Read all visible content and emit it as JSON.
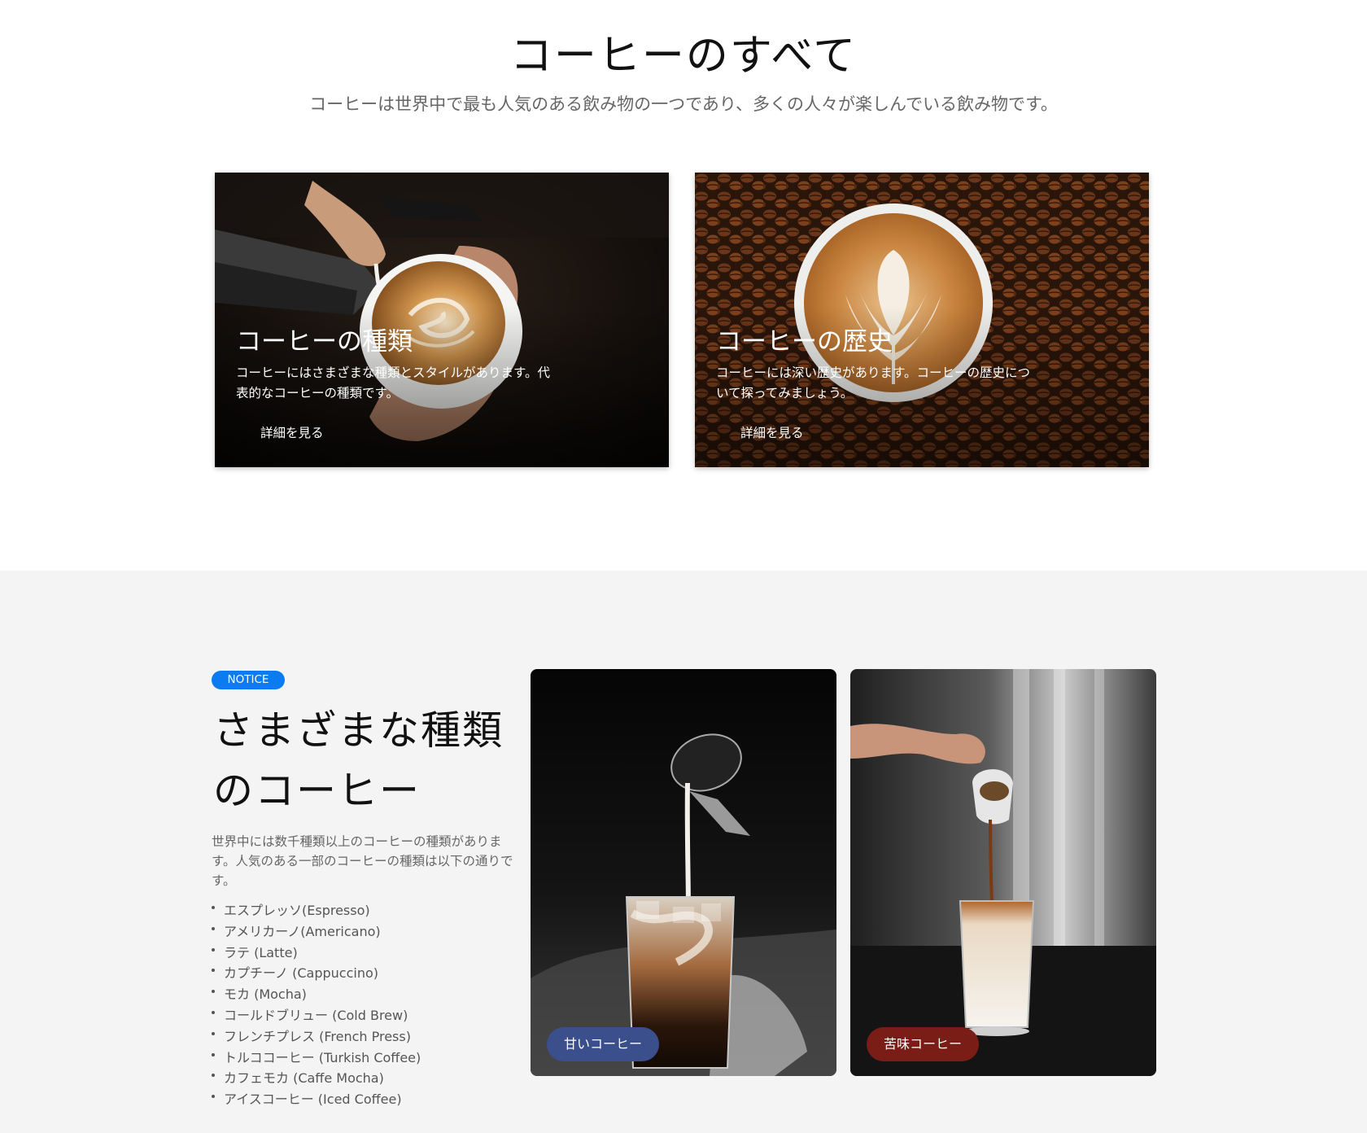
{
  "hero": {
    "title": "コーヒーのすべて",
    "subtitle": "コーヒーは世界中で最も人気のある飲み物の一つであり、多くの人々が楽しんでいる飲み物です。"
  },
  "cards": [
    {
      "title": "コーヒーの種類",
      "description": "コーヒーにはさまざまな種類とスタイルがあります。代表的なコーヒーの種類です。",
      "button": "詳細を見る"
    },
    {
      "title": "コーヒーの歴史",
      "description": "コーヒーには深い歴史があります。コーヒーの歴史について探ってみましょう。",
      "button": "詳細を見る"
    }
  ],
  "types_section": {
    "badge": "NOTICE",
    "heading": "さまざまな種類のコーヒー",
    "intro": "世界中には数千種類以上のコーヒーの種類があります。人気のある一部のコーヒーの種類は以下の通りです。",
    "items": [
      "エスプレッソ(Espresso)",
      "アメリカーノ(Americano)",
      "ラテ (Latte)",
      "カプチーノ (Cappuccino)",
      "モカ (Mocha)",
      "コールドブリュー (Cold Brew)",
      "フレンチプレス (French Press)",
      "トルココーヒー (Turkish Coffee)",
      "カフェモカ (Caffe Mocha)",
      "アイスコーヒー (Iced Coffee)"
    ],
    "photos": [
      {
        "label": "甘いコーヒー",
        "color": "#3b4f8c"
      },
      {
        "label": "苦味コーヒー",
        "color": "#7a1d17"
      }
    ]
  }
}
